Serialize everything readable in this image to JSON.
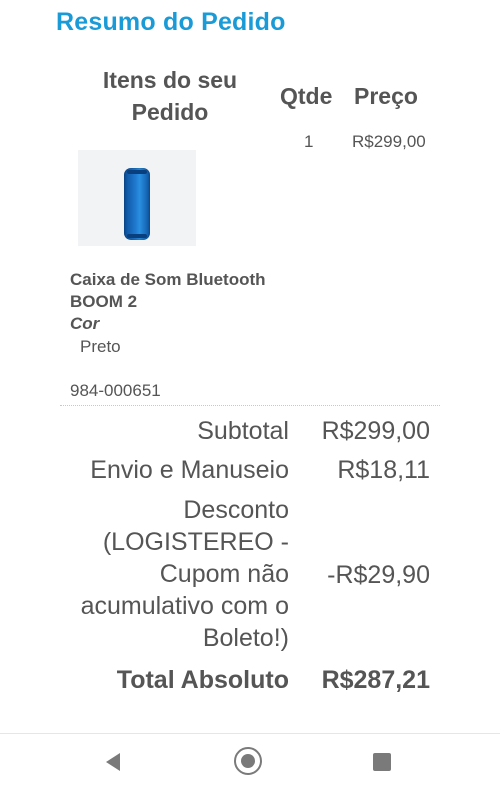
{
  "page_title": "Resumo do Pedido",
  "table_headers": {
    "items": "Itens do seu Pedido",
    "qty": "Qtde",
    "price": "Preço"
  },
  "item": {
    "qty": "1",
    "price": "R$299,00",
    "name": "Caixa de Som Bluetooth BOOM 2",
    "attribute_label": "Cor",
    "attribute_value": "Preto",
    "sku": "984-000651",
    "image_icon": "speaker-product-image",
    "image_color": "#1f7ad0"
  },
  "summary": {
    "subtotal_label": "Subtotal",
    "subtotal_value": "R$299,00",
    "shipping_label": "Envio e Manuseio",
    "shipping_value": "R$18,11",
    "discount_label": "Desconto (LOGISTEREO - Cupom não acumulativo com o Boleto!)",
    "discount_value": "-R$29,90",
    "total_label": "Total Absoluto",
    "total_value": "R$287,21"
  },
  "navbar": {
    "back_icon": "back-triangle-icon",
    "home_icon": "home-circle-icon",
    "recents_icon": "recents-square-icon"
  },
  "colors": {
    "accent": "#1a9bd7",
    "text": "#555555"
  }
}
